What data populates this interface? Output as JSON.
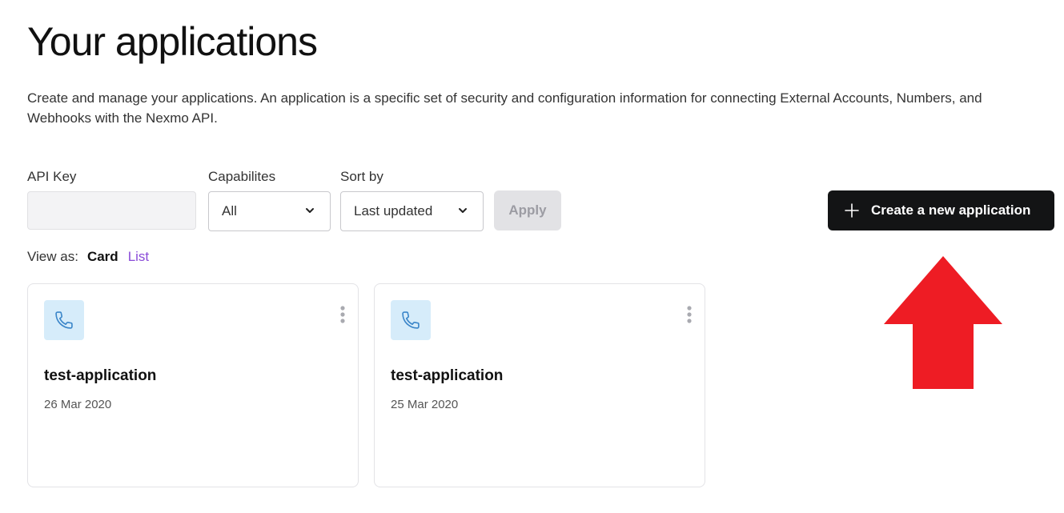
{
  "header": {
    "title": "Your applications",
    "description": "Create and manage your applications. An application is a specific set of security and configuration information for connecting External Accounts, Numbers, and Webhooks with the Nexmo API."
  },
  "filters": {
    "api_key_label": "API Key",
    "api_key_value": "",
    "capabilities_label": "Capabilites",
    "capabilities_value": "All",
    "sort_label": "Sort by",
    "sort_value": "Last updated",
    "apply_label": "Apply"
  },
  "actions": {
    "create_label": "Create a new application"
  },
  "view_as": {
    "label": "View as:",
    "card": "Card",
    "list": "List"
  },
  "cards": [
    {
      "name": "test-application",
      "date": "26 Mar 2020",
      "icon": "phone-icon"
    },
    {
      "name": "test-application",
      "date": "25 Mar 2020",
      "icon": "phone-icon"
    }
  ],
  "colors": {
    "accent_link": "#8a4bd8",
    "primary_button": "#131415",
    "icon_tile": "#d6ecfa",
    "annotation_arrow": "#ee1c24"
  }
}
